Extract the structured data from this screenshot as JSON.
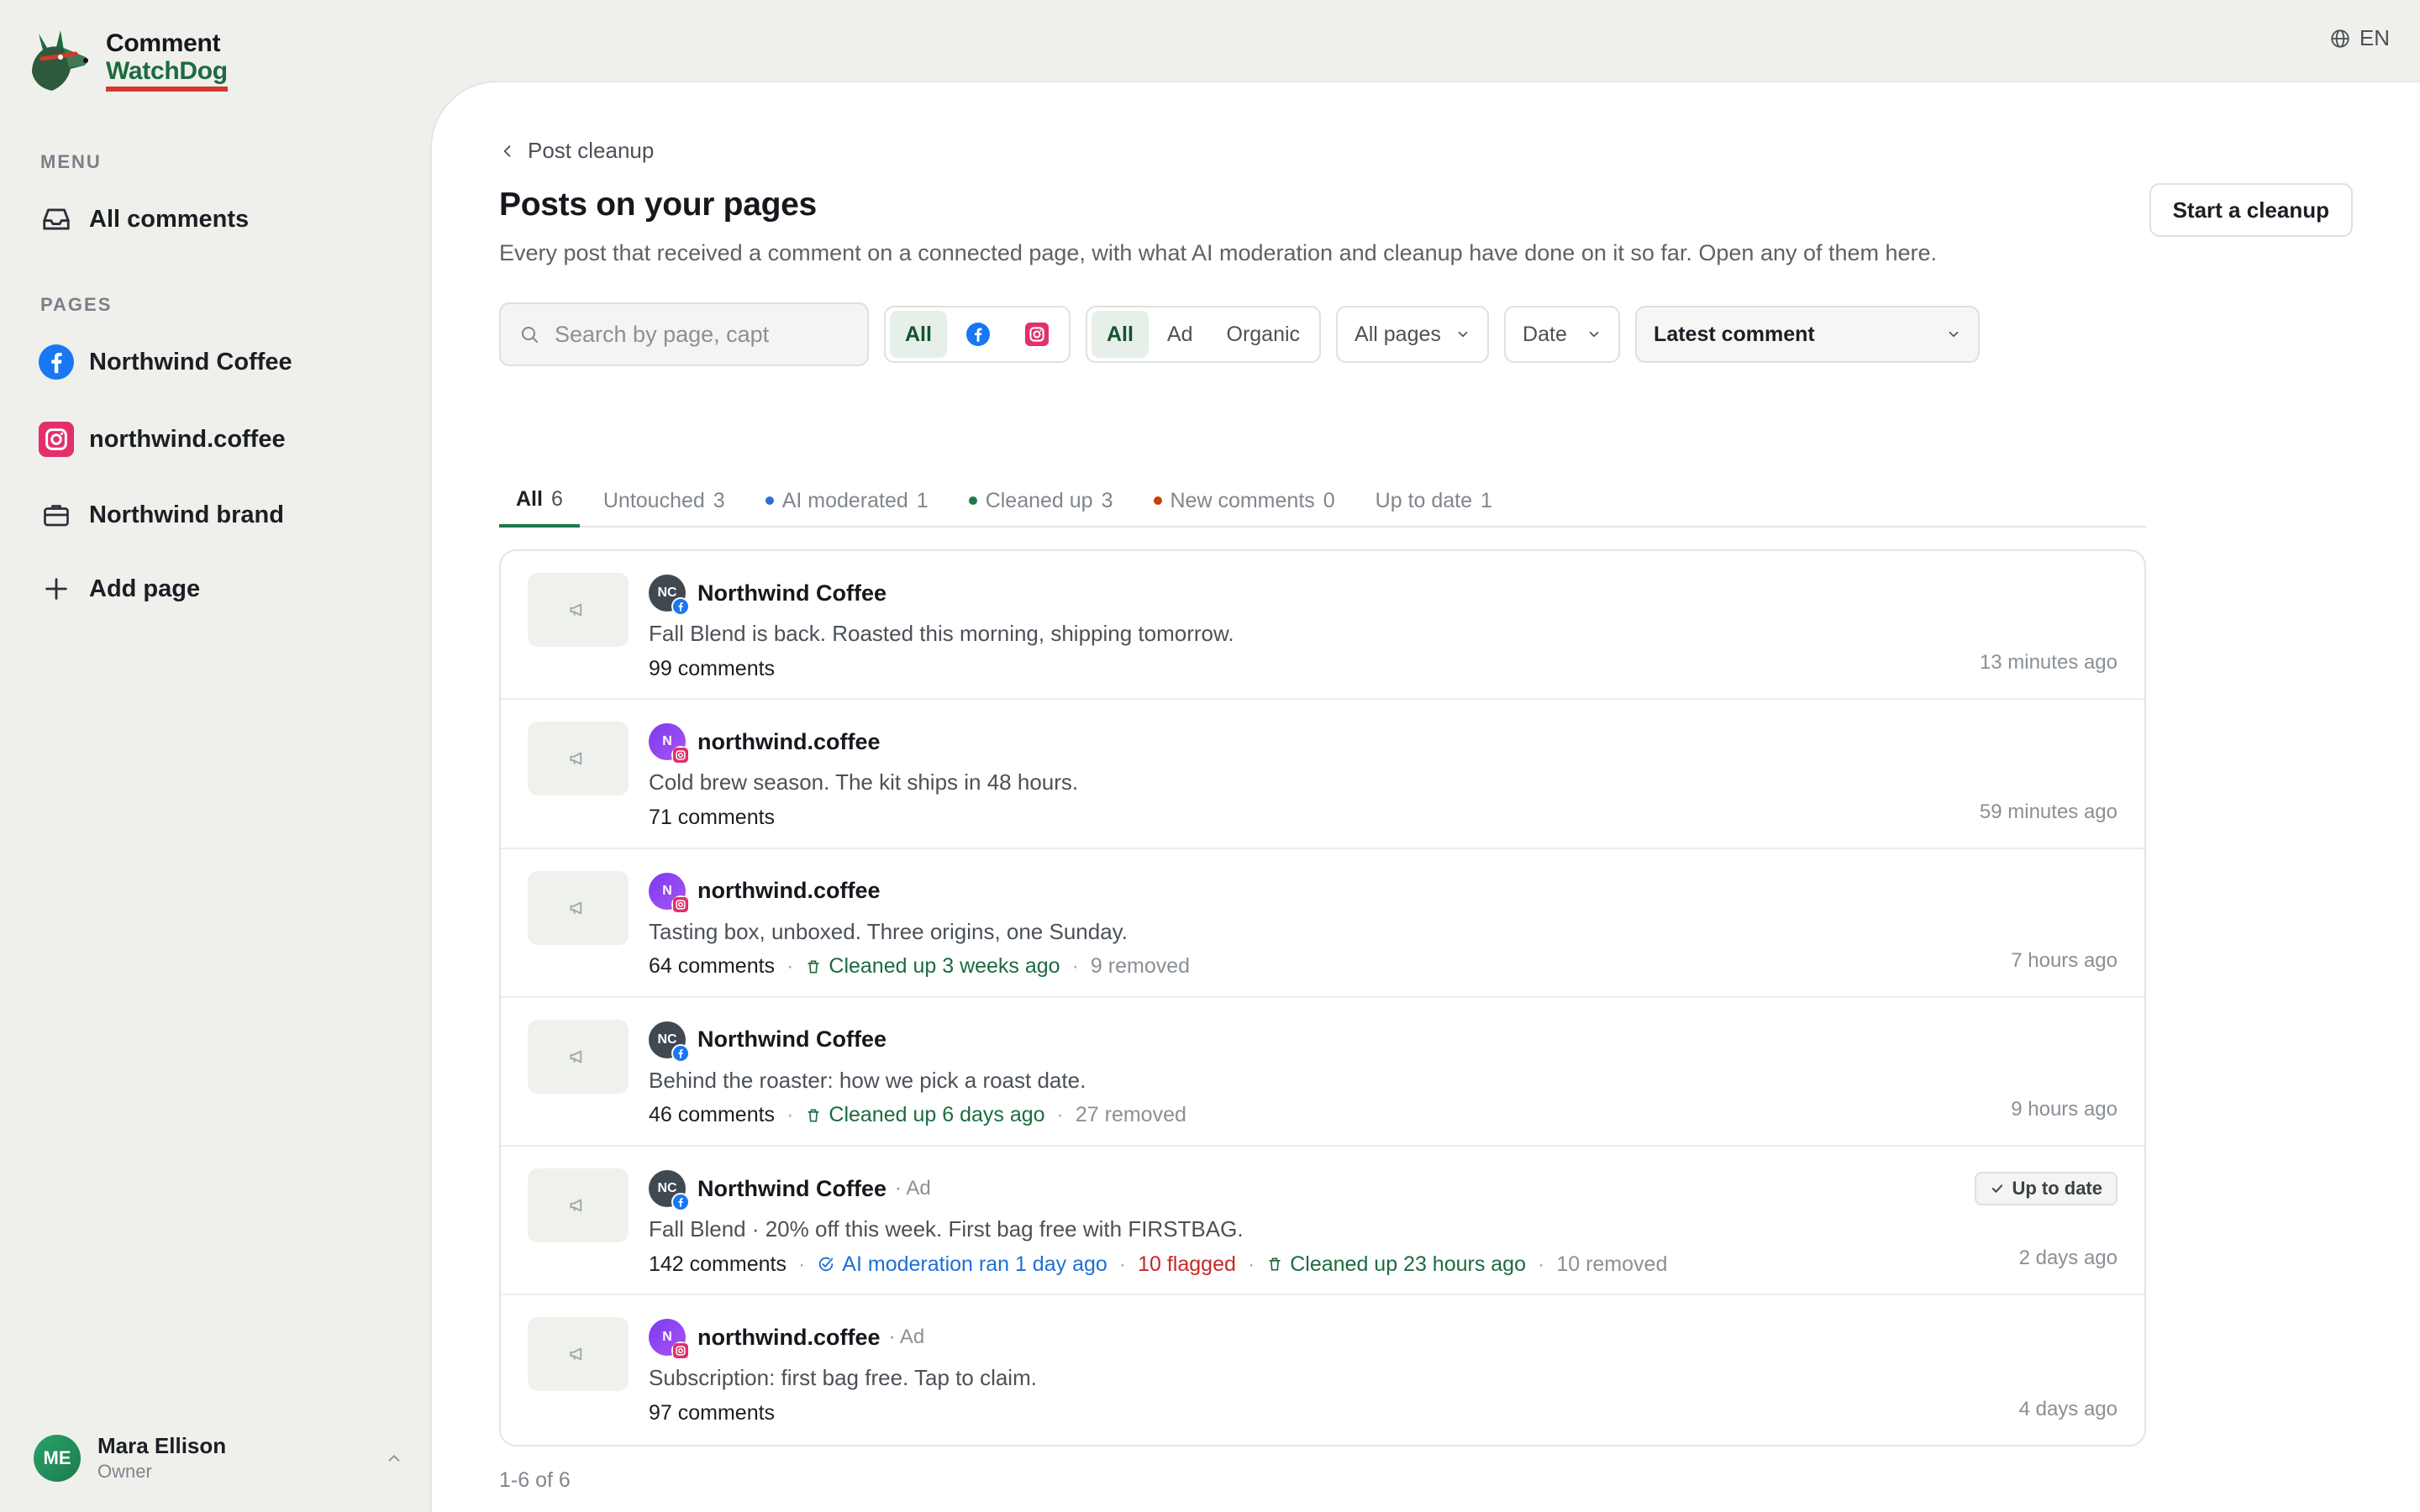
{
  "brand": {
    "line1": "Comment",
    "line2": "WatchDog"
  },
  "language": "EN",
  "sidebar": {
    "menu_heading": "MENU",
    "menu_items": [
      {
        "label": "All comments",
        "icon": "inbox-icon"
      }
    ],
    "pages_heading": "PAGES",
    "pages": [
      {
        "label": "Northwind Coffee",
        "icon": "facebook-icon"
      },
      {
        "label": "northwind.coffee",
        "icon": "instagram-icon"
      },
      {
        "label": "Northwind brand",
        "icon": "briefcase-icon"
      }
    ],
    "add_page": "Add page"
  },
  "user": {
    "initials": "ME",
    "name": "Mara Ellison",
    "role": "Owner"
  },
  "header": {
    "breadcrumb": "Post cleanup",
    "title": "Posts on your pages",
    "description": "Every post that received a comment on a connected page, with what AI moderation and cleanup have done on it so far. Open any of them here.",
    "start_button": "Start a cleanup"
  },
  "filters": {
    "search_placeholder": "Search by page, capt",
    "platform_all": "All",
    "type": [
      "All",
      "Ad",
      "Organic"
    ],
    "pages_dropdown": "All pages",
    "date_dropdown": "Date",
    "sort_dropdown": "Latest comment"
  },
  "tabs": [
    {
      "label": "All",
      "count": "6",
      "dot": ""
    },
    {
      "label": "Untouched",
      "count": "3",
      "dot": ""
    },
    {
      "label": "AI moderated",
      "count": "1",
      "dot": "#2d6fd6"
    },
    {
      "label": "Cleaned up",
      "count": "3",
      "dot": "#1c7a4d"
    },
    {
      "label": "New comments",
      "count": "0",
      "dot": "#c2410c"
    },
    {
      "label": "Up to date",
      "count": "1",
      "dot": ""
    }
  ],
  "posts": [
    {
      "page": "Northwind Coffee",
      "initials": "NC",
      "platform": "facebook",
      "ad": "",
      "caption": "Fall Blend is back. Roasted this morning, shipping tomorrow.",
      "comments": "99 comments",
      "ai": "",
      "flagged": "",
      "cleaned": "",
      "removed": "",
      "status": "",
      "time": "13 minutes ago"
    },
    {
      "page": "northwind.coffee",
      "initials": "N",
      "platform": "instagram",
      "ad": "",
      "caption": "Cold brew season. The kit ships in 48 hours.",
      "comments": "71 comments",
      "ai": "",
      "flagged": "",
      "cleaned": "",
      "removed": "",
      "status": "",
      "time": "59 minutes ago"
    },
    {
      "page": "northwind.coffee",
      "initials": "N",
      "platform": "instagram",
      "ad": "",
      "caption": "Tasting box, unboxed. Three origins, one Sunday.",
      "comments": "64 comments",
      "ai": "",
      "flagged": "",
      "cleaned": "Cleaned up 3 weeks ago",
      "removed": "9 removed",
      "status": "",
      "time": "7 hours ago"
    },
    {
      "page": "Northwind Coffee",
      "initials": "NC",
      "platform": "facebook",
      "ad": "",
      "caption": "Behind the roaster: how we pick a roast date.",
      "comments": "46 comments",
      "ai": "",
      "flagged": "",
      "cleaned": "Cleaned up 6 days ago",
      "removed": "27 removed",
      "status": "",
      "time": "9 hours ago"
    },
    {
      "page": "Northwind Coffee",
      "initials": "NC",
      "platform": "facebook",
      "ad": "· Ad",
      "caption": "Fall Blend · 20% off this week. First bag free with FIRSTBAG.",
      "comments": "142 comments",
      "ai": "AI moderation ran 1 day ago",
      "flagged": "10 flagged",
      "cleaned": "Cleaned up 23 hours ago",
      "removed": "10 removed",
      "status": "Up to date",
      "time": "2 days ago"
    },
    {
      "page": "northwind.coffee",
      "initials": "N",
      "platform": "instagram",
      "ad": "· Ad",
      "caption": "Subscription: first bag free. Tap to claim.",
      "comments": "97 comments",
      "ai": "",
      "flagged": "",
      "cleaned": "",
      "removed": "",
      "status": "",
      "time": "4 days ago"
    }
  ],
  "pagination": "1-6 of 6",
  "colors": {
    "accent": "#1c7a4d",
    "ai": "#1d6fd6",
    "flag": "#c62828",
    "brand_underline": "#d23a2c"
  }
}
